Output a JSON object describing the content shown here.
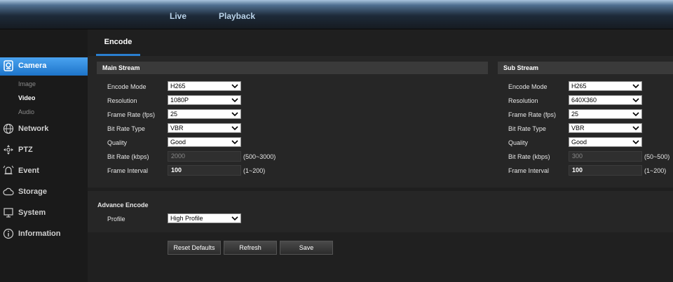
{
  "topnav": {
    "live": "Live",
    "playback": "Playback"
  },
  "tabs": {
    "encode": "Encode"
  },
  "sidebar": {
    "camera": "Camera",
    "camera_sub": [
      "Image",
      "Video",
      "Audio"
    ],
    "network": "Network",
    "ptz": "PTZ",
    "event": "Event",
    "storage": "Storage",
    "system": "System",
    "information": "Information"
  },
  "main_stream": {
    "title": "Main Stream",
    "encode_mode_label": "Encode Mode",
    "encode_mode": "H265",
    "resolution_label": "Resolution",
    "resolution": "1080P",
    "frame_rate_label": "Frame Rate (fps)",
    "frame_rate": "25",
    "bitrate_type_label": "Bit Rate Type",
    "bitrate_type": "VBR",
    "quality_label": "Quality",
    "quality": "Good",
    "bitrate_label": "Bit Rate (kbps)",
    "bitrate": "2000",
    "bitrate_range": "(500~3000)",
    "frame_interval_label": "Frame Interval",
    "frame_interval": "100",
    "frame_interval_range": "(1~200)"
  },
  "sub_stream": {
    "title": "Sub Stream",
    "encode_mode_label": "Encode Mode",
    "encode_mode": "H265",
    "resolution_label": "Resolution",
    "resolution": "640X360",
    "frame_rate_label": "Frame Rate (fps)",
    "frame_rate": "25",
    "bitrate_type_label": "Bit Rate Type",
    "bitrate_type": "VBR",
    "quality_label": "Quality",
    "quality": "Good",
    "bitrate_label": "Bit Rate (kbps)",
    "bitrate": "300",
    "bitrate_range": "(50~500)",
    "frame_interval_label": "Frame Interval",
    "frame_interval": "100",
    "frame_interval_range": "(1~200)"
  },
  "advance": {
    "title": "Advance Encode",
    "profile_label": "Profile",
    "profile": "High Profile"
  },
  "buttons": {
    "reset": "Reset Defaults",
    "refresh": "Refresh",
    "save": "Save"
  },
  "colors": {
    "accent": "#1d74c9",
    "tab_underline": "#2a7fd0"
  }
}
